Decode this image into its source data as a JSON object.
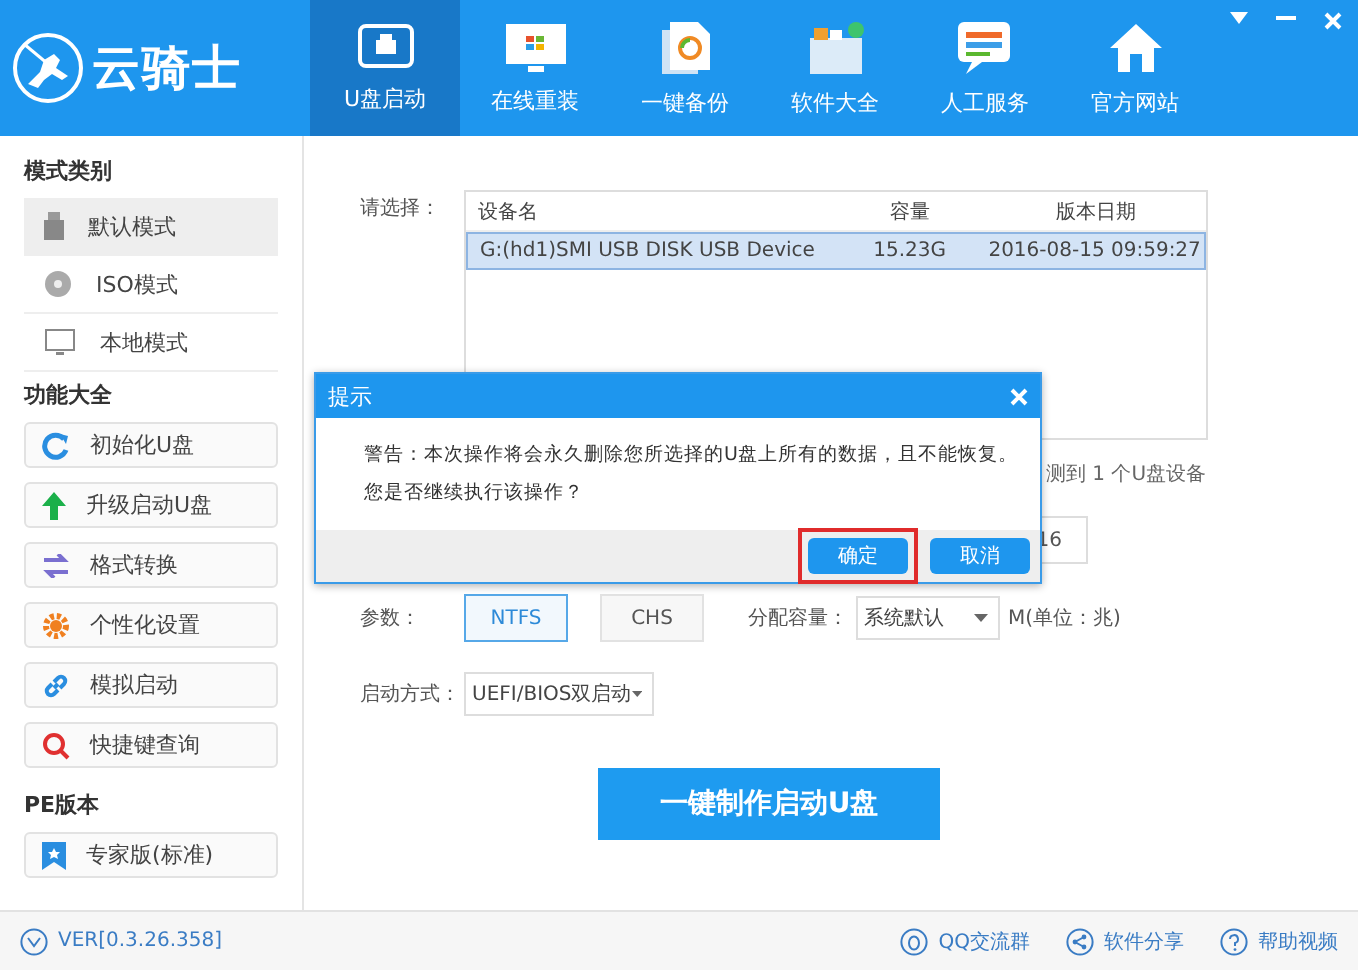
{
  "app": {
    "title": "云骑士"
  },
  "nav": [
    {
      "label": "U盘启动",
      "selected": true
    },
    {
      "label": "在线重装",
      "selected": false
    },
    {
      "label": "一键备份",
      "selected": false
    },
    {
      "label": "软件大全",
      "selected": false
    },
    {
      "label": "人工服务",
      "selected": false
    },
    {
      "label": "官方网站",
      "selected": false
    }
  ],
  "sidebar": [
    {
      "heading": "模式类别",
      "kind": "mode",
      "items": [
        {
          "label": "默认模式",
          "selected": true
        },
        {
          "label": "ISO模式",
          "selected": false
        },
        {
          "label": "本地模式",
          "selected": false
        }
      ]
    },
    {
      "heading": "功能大全",
      "kind": "tool",
      "items": [
        {
          "label": "初始化U盘"
        },
        {
          "label": "升级启动U盘"
        },
        {
          "label": "格式转换"
        },
        {
          "label": "个性化设置"
        },
        {
          "label": "模拟启动"
        },
        {
          "label": "快捷键查询"
        }
      ]
    },
    {
      "heading": "PE版本",
      "kind": "tool",
      "items": [
        {
          "label": "专家版(标准)"
        }
      ]
    }
  ],
  "device_select": {
    "label": "请选择：",
    "columns": [
      "设备名",
      "容量",
      "版本日期"
    ],
    "rows": [
      {
        "cells": [
          "G:(hd1)SMI USB DISK USB Device",
          "15.23G",
          "2016-08-15 09:59:27"
        ],
        "selected": true
      }
    ]
  },
  "detect_text": "测到 1 个U盘设备",
  "partial_button": "16",
  "params": {
    "label": "参数：",
    "options": [
      {
        "label": "NTFS",
        "selected": true
      },
      {
        "label": "CHS",
        "selected": false
      }
    ],
    "alloc_label": "分配容量：",
    "alloc_value": "系统默认",
    "unit": "M(单位：兆)"
  },
  "boot_mode": {
    "label": "启动方式：",
    "value": "UEFI/BIOS双启动"
  },
  "make_button": "一键制作启动U盘",
  "dialog": {
    "title": "提示",
    "lines": [
      "警告：本次操作将会永久删除您所选择的U盘上所有的数据，且不能恢复。",
      "您是否继续执行该操作？"
    ],
    "buttons": [
      {
        "label": "确定",
        "highlighted": true
      },
      {
        "label": "取消",
        "highlighted": false
      }
    ]
  },
  "footer": {
    "version": "VER[0.3.26.358]",
    "links": [
      "QQ交流群",
      "软件分享",
      "帮助视频"
    ]
  }
}
